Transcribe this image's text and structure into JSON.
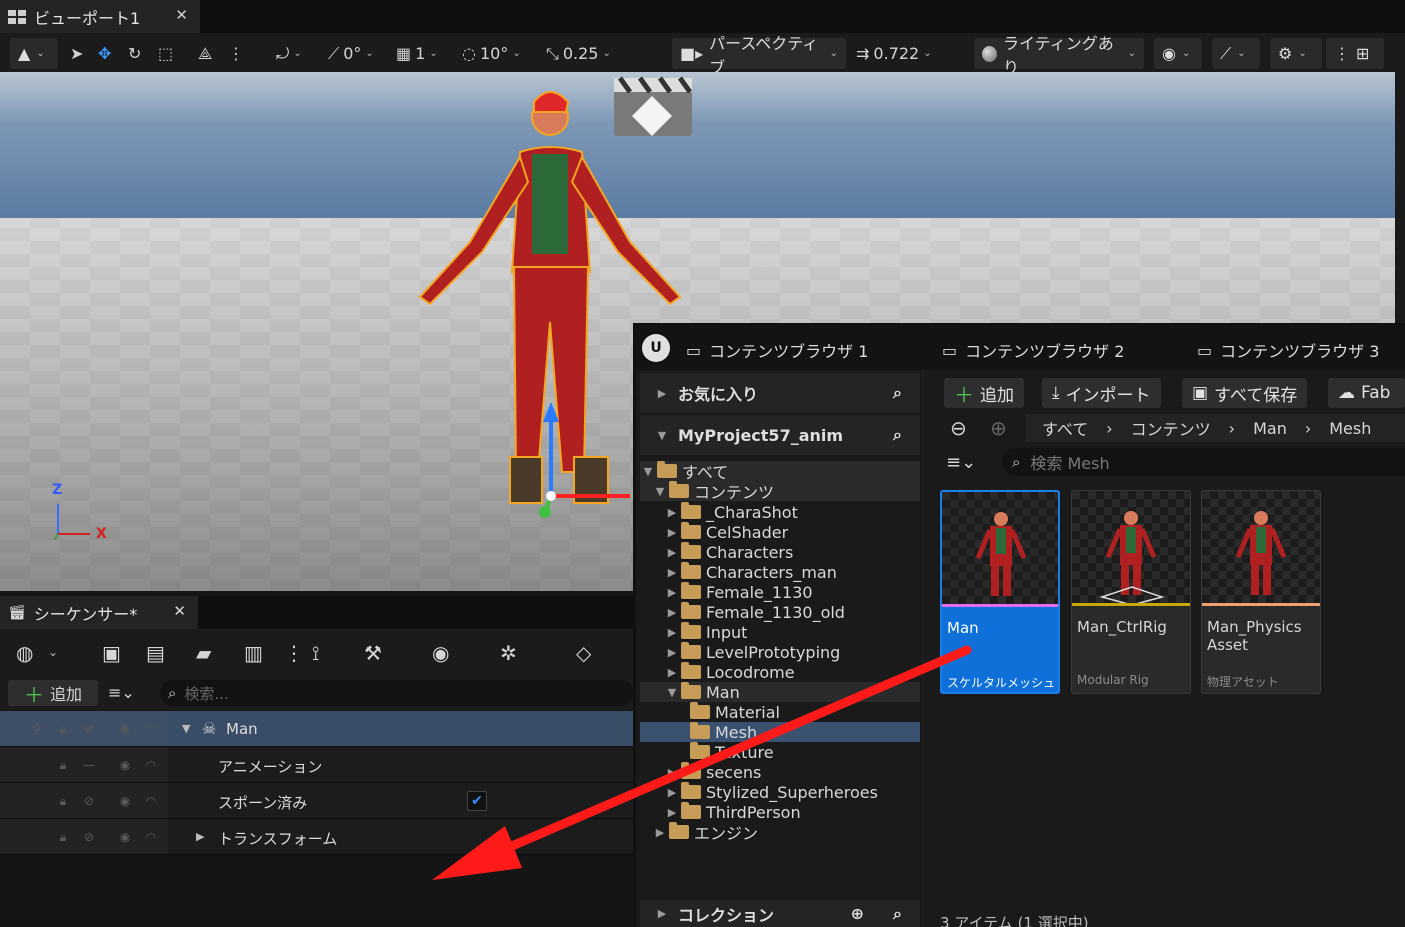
{
  "viewport": {
    "tab_title": "ビューポート1",
    "toolbar": {
      "rotation_snap": "0°",
      "grid_size": "1",
      "angle_snap": "10°",
      "scale_snap": "0.25",
      "perspective_label": "パースペクティブ",
      "camera_speed": "0.722",
      "lighting_label": "ライティングあり"
    },
    "axis_labels": {
      "z": "Z",
      "x": "X"
    }
  },
  "sequencer": {
    "tab_title": "シーケンサー*",
    "add_label": "追加",
    "search_placeholder": "検索...",
    "tracks": [
      {
        "label": "Man"
      },
      {
        "label": "アニメーション"
      },
      {
        "label": "スポーン済み",
        "checked": true
      },
      {
        "label": "トランスフォーム"
      }
    ]
  },
  "content_browser": {
    "tabs": [
      {
        "label": "コンテンツブラウザ 1"
      },
      {
        "label": "コンテンツブラウザ 2"
      },
      {
        "label": "コンテンツブラウザ 3"
      }
    ],
    "favorites_label": "お気に入り",
    "project_label": "MyProject57_anim",
    "collections_label": "コレクション",
    "buttons": {
      "add": "追加",
      "import": "インポート",
      "save_all": "すべて保存",
      "fab": "Fab"
    },
    "breadcrumb": [
      "すべて",
      "コンテンツ",
      "Man",
      "Mesh"
    ],
    "search_placeholder": "検索 Mesh",
    "tree": {
      "root": "すべて",
      "content": "コンテンツ",
      "folders": [
        "_CharaShot",
        "CelShader",
        "Characters",
        "Characters_man",
        "Female_1130",
        "Female_1130_old",
        "Input",
        "LevelPrototyping",
        "Locodrome",
        "Man"
      ],
      "man_children": [
        "Material",
        "Mesh",
        "Texture"
      ],
      "after": [
        "secens",
        "Stylized_Superheroes",
        "ThirdPerson"
      ],
      "engine": "エンジン"
    },
    "assets": [
      {
        "name": "Man",
        "type": "スケルタルメッシュ",
        "color": "#e86cf0"
      },
      {
        "name": "Man_CtrlRig",
        "type": "Modular Rig",
        "color": "#c8a800"
      },
      {
        "name": "Man_Physics Asset",
        "type": "物理アセット",
        "color": "#f0a070"
      }
    ],
    "status": "3 アイテム (1 選択中)"
  },
  "colors": {
    "arrow": "#ff1a1a",
    "selection": "#0e70d8",
    "folder": "#c69c56"
  }
}
